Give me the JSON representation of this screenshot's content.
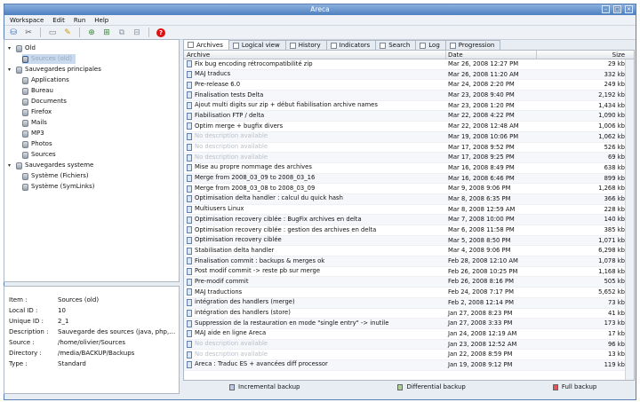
{
  "window": {
    "title": "Areca",
    "btn_min": "–",
    "btn_max": "□",
    "btn_close": "✕"
  },
  "menu": [
    "Workspace",
    "Edit",
    "Run",
    "Help"
  ],
  "tree": {
    "root": "Old",
    "selected": "Sources (old)",
    "group1": "Sauvegardes principales",
    "group1_items": [
      "Applications",
      "Bureau",
      "Documents",
      "Firefox",
      "Mails",
      "MP3",
      "Photos",
      "Sources"
    ],
    "group2": "Sauvegardes systeme",
    "group2_items": [
      "Système (Fichiers)",
      "Système (SymLinks)"
    ]
  },
  "properties": [
    {
      "key": "Item :",
      "value": "Sources (old)"
    },
    {
      "key": "Local ID :",
      "value": "10"
    },
    {
      "key": "Unique ID :",
      "value": "2_1"
    },
    {
      "key": "Description :",
      "value": "Sauvegarde des sources (java, php, c, etc."
    },
    {
      "key": "Source :",
      "value": "/home/olivier/Sources"
    },
    {
      "key": "Directory :",
      "value": "/media/BACKUP/Backups"
    },
    {
      "key": "Type :",
      "value": "Standard"
    }
  ],
  "tabs": [
    "Archives",
    "Logical view",
    "History",
    "Indicators",
    "Search",
    "Log",
    "Progression"
  ],
  "columns": {
    "archive": "Archive",
    "date": "Date",
    "size": "Size"
  },
  "archives": [
    {
      "name": "Fix bug encoding rétrocompatibilité zip",
      "date": "Mar 26, 2008 12:27 PM",
      "size": "29 kb",
      "dim": false
    },
    {
      "name": "MAJ traducs",
      "date": "Mar 26, 2008 11:20 AM",
      "size": "332 kb",
      "dim": false
    },
    {
      "name": "Pre-release 6.0",
      "date": "Mar 24, 2008 2:20 PM",
      "size": "249 kb",
      "dim": false
    },
    {
      "name": "Finalisation tests Delta",
      "date": "Mar 23, 2008 9:40 PM",
      "size": "2,192 kb",
      "dim": false
    },
    {
      "name": "Ajout multi digits sur zip + début fiabilisation archive names",
      "date": "Mar 23, 2008 1:20 PM",
      "size": "1,434 kb",
      "dim": false
    },
    {
      "name": "Fiabilisation FTP / delta",
      "date": "Mar 22, 2008 4:22 PM",
      "size": "1,090 kb",
      "dim": false
    },
    {
      "name": "Optim merge + bugfix divers",
      "date": "Mar 22, 2008 12:48 AM",
      "size": "1,006 kb",
      "dim": false
    },
    {
      "name": "No description available",
      "date": "Mar 19, 2008 10:06 PM",
      "size": "1,062 kb",
      "dim": true
    },
    {
      "name": "No description available",
      "date": "Mar 17, 2008 9:52 PM",
      "size": "526 kb",
      "dim": true
    },
    {
      "name": "No description available",
      "date": "Mar 17, 2008 9:25 PM",
      "size": "69 kb",
      "dim": true
    },
    {
      "name": "Mise au propre nommage des archives",
      "date": "Mar 16, 2008 8:49 PM",
      "size": "638 kb",
      "dim": false
    },
    {
      "name": "Merge from 2008_03_09 to 2008_03_16",
      "date": "Mar 16, 2008 6:46 PM",
      "size": "899 kb",
      "dim": false
    },
    {
      "name": "Merge from 2008_03_08 to 2008_03_09",
      "date": "Mar 9, 2008 9:06 PM",
      "size": "1,268 kb",
      "dim": false
    },
    {
      "name": "Optimisation delta handler : calcul du quick hash",
      "date": "Mar 8, 2008 6:35 PM",
      "size": "366 kb",
      "dim": false
    },
    {
      "name": "Multiusers Linux",
      "date": "Mar 8, 2008 12:59 AM",
      "size": "228 kb",
      "dim": false
    },
    {
      "name": "Optimisation recovery ciblée : BugFix archives en delta",
      "date": "Mar 7, 2008 10:00 PM",
      "size": "140 kb",
      "dim": false
    },
    {
      "name": "Optimisation recovery ciblée : gestion des archives en delta",
      "date": "Mar 6, 2008 11:58 PM",
      "size": "385 kb",
      "dim": false
    },
    {
      "name": "Optimisation recovery ciblée",
      "date": "Mar 5, 2008 8:50 PM",
      "size": "1,071 kb",
      "dim": false
    },
    {
      "name": "Stabilisation delta handler",
      "date": "Mar 4, 2008 9:06 PM",
      "size": "6,298 kb",
      "dim": false
    },
    {
      "name": "Finalisation commit : backups & merges ok",
      "date": "Feb 28, 2008 12:10 AM",
      "size": "1,078 kb",
      "dim": false
    },
    {
      "name": "Post modif commit -> reste pb sur merge",
      "date": "Feb 26, 2008 10:25 PM",
      "size": "1,168 kb",
      "dim": false
    },
    {
      "name": "Pre-modif commit",
      "date": "Feb 26, 2008 8:16 PM",
      "size": "505 kb",
      "dim": false
    },
    {
      "name": "MAJ traductions",
      "date": "Feb 24, 2008 7:17 PM",
      "size": "5,652 kb",
      "dim": false
    },
    {
      "name": "intégration des handlers (merge)",
      "date": "Feb 2, 2008 12:14 PM",
      "size": "73 kb",
      "dim": false
    },
    {
      "name": "intégration des handlers (store)",
      "date": "Jan 27, 2008 8:23 PM",
      "size": "41 kb",
      "dim": false
    },
    {
      "name": "Suppression de la restauration en mode \"single entry\" -> inutile",
      "date": "Jan 27, 2008 3:33 PM",
      "size": "173 kb",
      "dim": false
    },
    {
      "name": "MAJ aide en ligne Areca",
      "date": "Jan 24, 2008 12:19 AM",
      "size": "17 kb",
      "dim": false
    },
    {
      "name": "No description available",
      "date": "Jan 23, 2008 12:52 AM",
      "size": "96 kb",
      "dim": true
    },
    {
      "name": "No description available",
      "date": "Jan 22, 2008 8:59 PM",
      "size": "13 kb",
      "dim": true
    },
    {
      "name": "Areca : Traduc ES + avancées diff processor",
      "date": "Jan 19, 2008 9:12 PM",
      "size": "119 kb",
      "dim": false
    }
  ],
  "legend": {
    "incremental": "Incremental backup",
    "differential": "Differential backup",
    "full": "Full backup",
    "colors": {
      "incremental": "#b9c9e6",
      "differential": "#a9d08e",
      "full": "#e25555"
    }
  }
}
